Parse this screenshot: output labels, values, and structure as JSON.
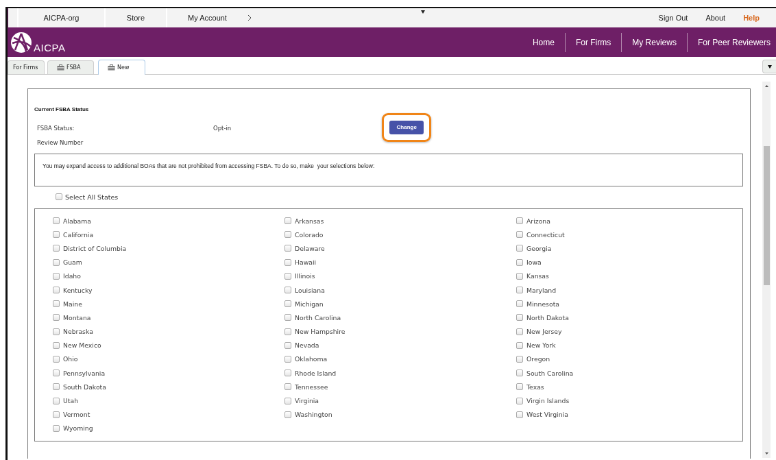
{
  "top_links": [
    {
      "label": "AICPA-org"
    },
    {
      "label": "Store"
    },
    {
      "label": "My Account"
    }
  ],
  "account_links": [
    {
      "label": "Sign Out",
      "highlighted": false
    },
    {
      "label": "About",
      "highlighted": false
    },
    {
      "label": "Help",
      "highlighted": true
    }
  ],
  "brand": {
    "name": "AICPA"
  },
  "nav": [
    {
      "label": "Home"
    },
    {
      "label": "For Firms"
    },
    {
      "label": "My Reviews"
    },
    {
      "label": "For Peer Reviewers"
    }
  ],
  "tabs": [
    {
      "label": "For Firms",
      "selected": false,
      "icon": false
    },
    {
      "label": "FSBA",
      "selected": false,
      "icon": true
    },
    {
      "label": "New",
      "selected": true,
      "icon": true
    }
  ],
  "status": {
    "heading": "Current FSBA Status",
    "fields": [
      {
        "label": "FSBA Status:",
        "value": "Opt-in"
      },
      {
        "label": "Review Number"
      }
    ],
    "button": {
      "label": "Change",
      "highlighted": true
    }
  },
  "notice": "You may expand access to additional BOAs that are not prohibited from accessing FSBA. To do so, make  your selections below:",
  "select_all": {
    "label": "Select All States",
    "checked": false
  },
  "states": [
    {
      "label": "Alabama",
      "checked": false
    },
    {
      "label": "Arkansas",
      "checked": false
    },
    {
      "label": "Arizona",
      "checked": false
    },
    {
      "label": "California",
      "checked": false
    },
    {
      "label": "Colorado",
      "checked": false
    },
    {
      "label": "Connecticut",
      "checked": false
    },
    {
      "label": "District of Columbia",
      "checked": false
    },
    {
      "label": "Delaware",
      "checked": false
    },
    {
      "label": "Georgia",
      "checked": false
    },
    {
      "label": "Guam",
      "checked": false
    },
    {
      "label": "Hawaii",
      "checked": false
    },
    {
      "label": "Iowa",
      "checked": false
    },
    {
      "label": "Idaho",
      "checked": false
    },
    {
      "label": "Illinois",
      "checked": false
    },
    {
      "label": "Kansas",
      "checked": false
    },
    {
      "label": "Kentucky",
      "checked": false
    },
    {
      "label": "Louisiana",
      "checked": false
    },
    {
      "label": "Maryland",
      "checked": false
    },
    {
      "label": "Maine",
      "checked": false
    },
    {
      "label": "Michigan",
      "checked": false
    },
    {
      "label": "Minnesota",
      "checked": false
    },
    {
      "label": "Montana",
      "checked": false
    },
    {
      "label": "North Carolina",
      "checked": false
    },
    {
      "label": "North Dakota",
      "checked": false
    },
    {
      "label": "Nebraska",
      "checked": false
    },
    {
      "label": "New Hampshire",
      "checked": false
    },
    {
      "label": "New Jersey",
      "checked": false
    },
    {
      "label": "New Mexico",
      "checked": false
    },
    {
      "label": "Nevada",
      "checked": false
    },
    {
      "label": "New York",
      "checked": false
    },
    {
      "label": "Ohio",
      "checked": false
    },
    {
      "label": "Oklahoma",
      "checked": false
    },
    {
      "label": "Oregon",
      "checked": false
    },
    {
      "label": "Pennsylvania",
      "checked": false
    },
    {
      "label": "Rhode Island",
      "checked": false
    },
    {
      "label": "South Carolina",
      "checked": false
    },
    {
      "label": "South Dakota",
      "checked": false
    },
    {
      "label": "Tennessee",
      "checked": false
    },
    {
      "label": "Texas",
      "checked": false
    },
    {
      "label": "Utah",
      "checked": false
    },
    {
      "label": "Virginia",
      "checked": false
    },
    {
      "label": "Virgin Islands",
      "checked": false
    },
    {
      "label": "Vermont",
      "checked": false
    },
    {
      "label": "Washington",
      "checked": false
    },
    {
      "label": "West Virginia",
      "checked": false
    },
    {
      "label": "Wyoming",
      "checked": false
    }
  ]
}
